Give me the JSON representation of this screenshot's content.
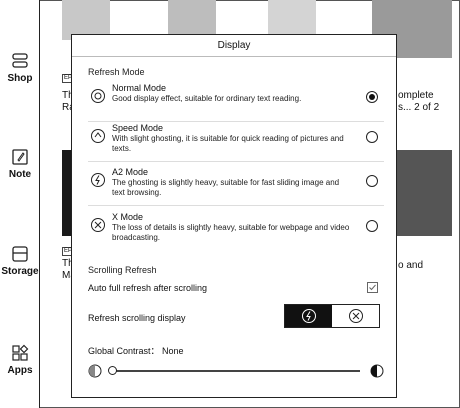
{
  "sidebar": {
    "items": [
      {
        "label": "Shop",
        "icon": "shop-icon"
      },
      {
        "label": "Note",
        "icon": "note-icon"
      },
      {
        "label": "Storage",
        "icon": "storage-icon"
      },
      {
        "label": "Apps",
        "icon": "apps-icon"
      }
    ]
  },
  "background": {
    "book1_badge": "EP",
    "book1_text_l1": "Th",
    "book1_text_l2": "Ra",
    "book_right_l1": "omplete",
    "book_right_l2": "s... 2 of 2",
    "book2_badge": "EP",
    "book2_text_l1": "Th",
    "book2_text_l2": "Ma",
    "book_right2_l1": "o and"
  },
  "dialog": {
    "title": "Display",
    "refresh_mode_heading": "Refresh Mode",
    "modes": [
      {
        "title": "Normal Mode",
        "desc": "Good display effect, suitable for ordinary text reading.",
        "selected": true,
        "icon": "normal-mode-icon"
      },
      {
        "title": "Speed Mode",
        "desc": "With slight ghosting, it is suitable for quick reading of pictures and texts.",
        "selected": false,
        "icon": "speed-mode-icon"
      },
      {
        "title": "A2 Mode",
        "desc": "The ghosting is slightly heavy, suitable for fast sliding image and text browsing.",
        "selected": false,
        "icon": "a2-mode-icon"
      },
      {
        "title": "X Mode",
        "desc": "The loss of details is slightly heavy, suitable for webpage and video broadcasting.",
        "selected": false,
        "icon": "x-mode-icon"
      }
    ],
    "scrolling_refresh_heading": "Scrolling Refresh",
    "auto_full_refresh_label": "Auto full refresh after scrolling",
    "auto_full_refresh_checked": true,
    "refresh_scrolling_display_label": "Refresh scrolling display",
    "global_contrast_label": "Global Contrast： None",
    "contrast_level": 0
  }
}
